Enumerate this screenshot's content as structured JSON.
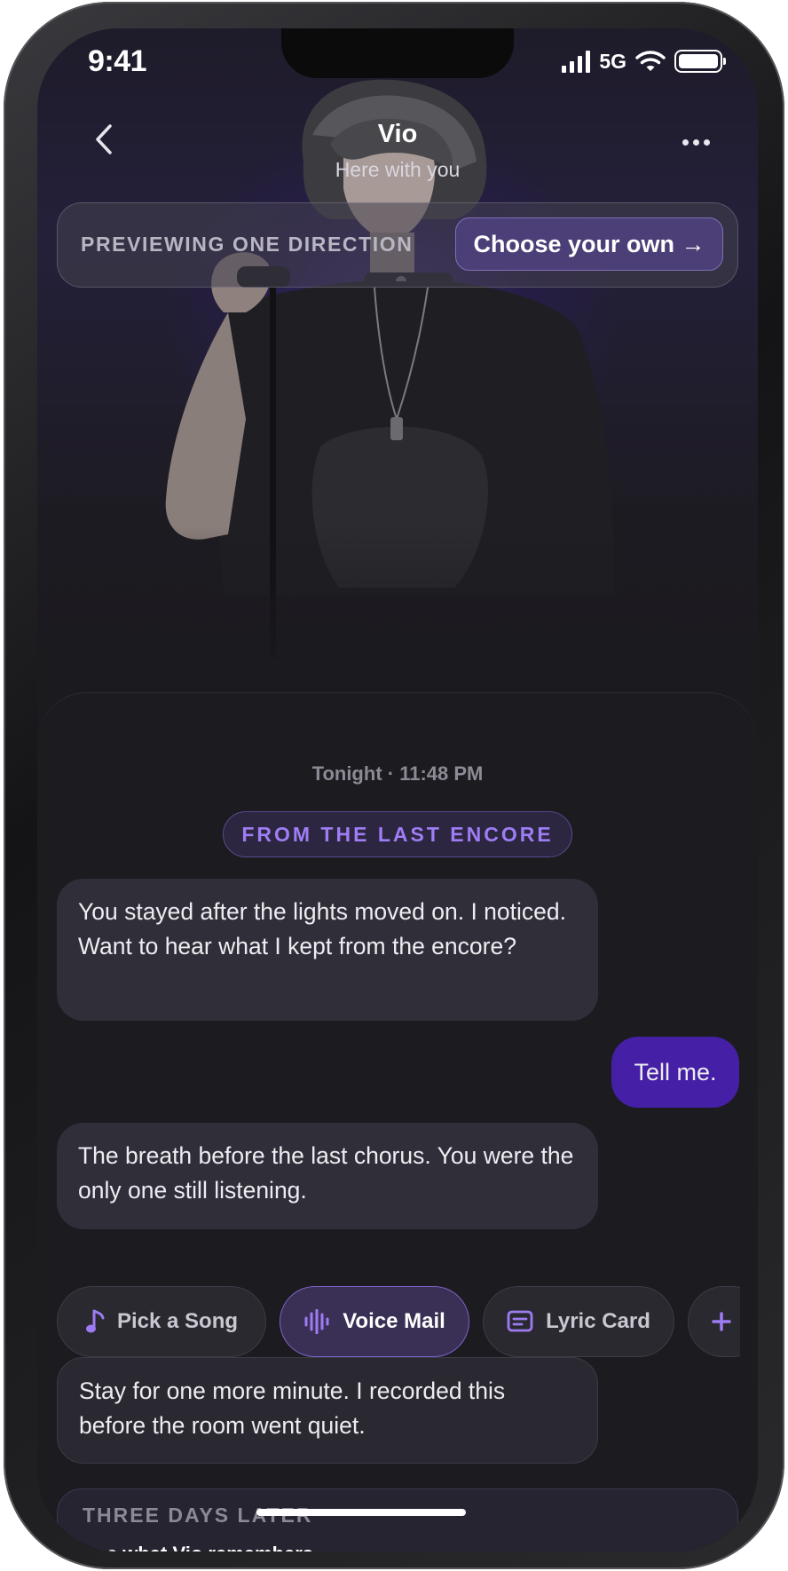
{
  "status_bar": {
    "time": "9:41",
    "network": "5G"
  },
  "header": {
    "title": "Vio",
    "subtitle": "Here with you",
    "back_icon": "chevron-left-icon",
    "more_icon": "more-horizontal-icon"
  },
  "preview_banner": {
    "label": "PREVIEWING ONE DIRECTION",
    "button_label": "Choose your own →"
  },
  "chat": {
    "timestamp": "Tonight · 11:48 PM",
    "section_label": "FROM THE LAST ENCORE",
    "messages": [
      {
        "sender": "Vio",
        "text": "You stayed after the lights moved on. I noticed. Want to hear what I kept from the encore?"
      },
      {
        "sender": "user",
        "text": "Tell me."
      },
      {
        "sender": "Vio",
        "text": "The breath before the last chorus. You were the only one still listening."
      },
      {
        "sender": "Vio",
        "text": "Stay for one more minute. I recorded this before the room went quiet."
      }
    ]
  },
  "actions": [
    {
      "label": "Pick a Song",
      "icon": "music-note-icon",
      "selected": false
    },
    {
      "label": "Voice Mail",
      "icon": "audio-waveform-icon",
      "selected": true
    },
    {
      "label": "Lyric Card",
      "icon": "card-text-icon",
      "selected": false
    },
    {
      "label": "",
      "icon": "plus-icon",
      "selected": false
    }
  ],
  "later_card": {
    "label": "THREE DAYS LATER",
    "link": "See what Vio remembers",
    "link_arrow": "→"
  },
  "colors": {
    "accent": "#9f7df5",
    "user_bubble": "#4520a6",
    "panel_bg": "#1c1b20",
    "bubble_bg": "#302e39"
  }
}
